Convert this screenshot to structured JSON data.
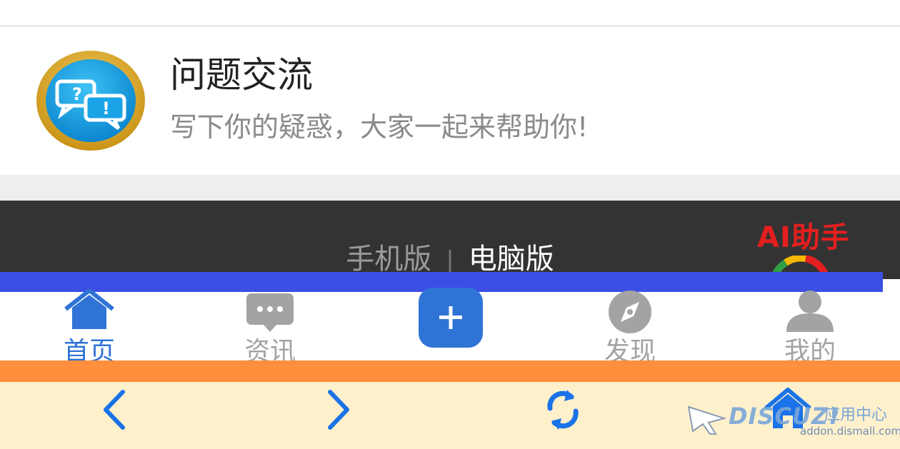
{
  "forum": {
    "title": "问题交流",
    "description": "写下你的疑惑，大家一起来帮助你!",
    "icon": "chat-bubbles-icon"
  },
  "footer": {
    "mobile_label": "手机版",
    "separator": "|",
    "pc_label": "电脑版",
    "ai_badge": "AI助手"
  },
  "tabbar": {
    "items": [
      {
        "label": "首页",
        "icon": "home-icon",
        "active": true
      },
      {
        "label": "资讯",
        "icon": "message-icon",
        "active": false
      },
      {
        "label": "",
        "icon": "plus-icon",
        "active": false
      },
      {
        "label": "发现",
        "icon": "compass-icon",
        "active": false
      },
      {
        "label": "我的",
        "icon": "user-icon",
        "active": false
      }
    ]
  },
  "browser_nav": {
    "buttons": [
      "back-icon",
      "forward-icon",
      "refresh-icon",
      "home-icon"
    ]
  },
  "watermark": {
    "logo": "DISCUZ!",
    "label": "应用中心",
    "url": "addon.dismall.com"
  },
  "colors": {
    "accent_blue": "#2f73d6",
    "stripe_blue": "#3b4fe4",
    "stripe_orange": "#ff8f3c",
    "browser_bar": "#fff0cc",
    "footer_dark": "#333333",
    "ai_red": "#e41f1f"
  }
}
